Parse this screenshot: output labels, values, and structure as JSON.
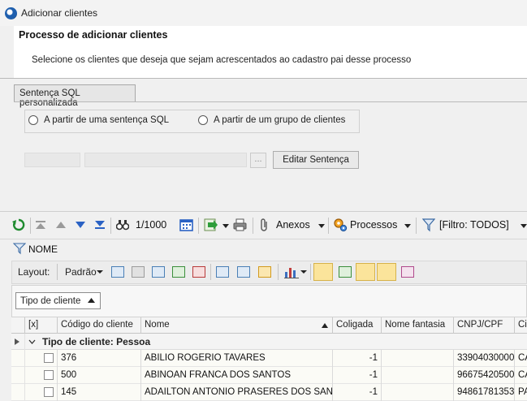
{
  "window": {
    "title": "Adicionar clientes"
  },
  "header": {
    "title": "Processo de adicionar clientes",
    "description": "Selecione os clientes que deseja que sejam acrescentados ao cadastro pai desse processo"
  },
  "tab": {
    "label": "Sentença SQL personalizada"
  },
  "options": {
    "sql": "A partir de uma sentença SQL",
    "group": "A partir de um grupo de clientes"
  },
  "editor": {
    "ellipsis": "...",
    "edit_button": "Editar Sentença"
  },
  "toolbar": {
    "page": "1/1000",
    "attachments": "Anexos",
    "processes": "Processos",
    "filter": "[Filtro: TODOS]"
  },
  "filter_row": {
    "label": "NOME"
  },
  "layout_bar": {
    "layout_label": "Layout:",
    "layout_value": "Padrão"
  },
  "grouping": {
    "chip": "Tipo de cliente"
  },
  "grid": {
    "columns": [
      "[x]",
      "Código do cliente",
      "Nome",
      "Coligada",
      "Nome fantasia",
      "CNPJ/CPF",
      "Cid"
    ],
    "group_label": "Tipo de cliente: Pessoa",
    "rows": [
      {
        "code": "376",
        "name": "ABILIO ROGERIO TAVARES",
        "coligada": "-1",
        "fantasia": "",
        "cnpj": "33904030000",
        "cid": "CA"
      },
      {
        "code": "500",
        "name": "ABINOAN FRANCA DOS SANTOS",
        "coligada": "-1",
        "fantasia": "",
        "cnpj": "96675420500",
        "cid": "CA"
      },
      {
        "code": "145",
        "name": "ADAILTON ANTONIO PRASERES DOS SANTOS",
        "coligada": "-1",
        "fantasia": "",
        "cnpj": "94861781353",
        "cid": "PA"
      }
    ]
  }
}
